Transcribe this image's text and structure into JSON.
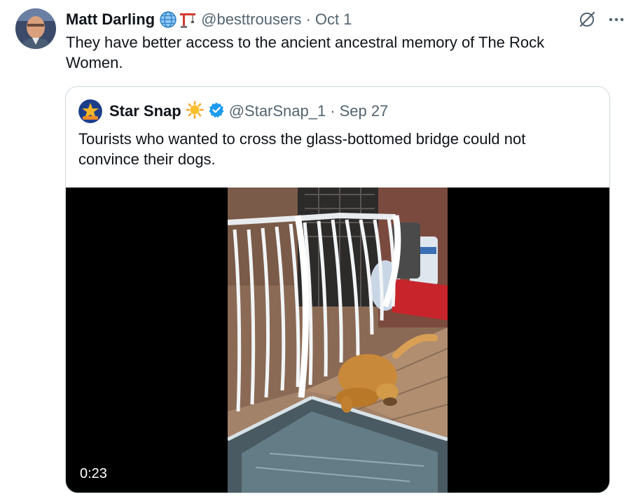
{
  "tweet": {
    "author_name": "Matt Darling",
    "handle": "@besttrousers",
    "separator": "·",
    "date": "Oct 1",
    "text": "They have better access to the ancient ancestral memory of The Rock Women.",
    "icons": [
      "globe-icon",
      "crane-icon",
      "grok-icon",
      "more-icon"
    ]
  },
  "quote": {
    "author_name": "Star Snap",
    "handle": "@StarSnap_1",
    "separator": "·",
    "date": "Sep 27",
    "text": "Tourists who wanted to cross the glass-bottomed bridge could not convince their dogs.",
    "icons": [
      "sun-emoji-icon",
      "verified-badge-icon"
    ],
    "video": {
      "timestamp": "0:23"
    }
  },
  "colors": {
    "text_primary": "#0f1419",
    "text_secondary": "#536471",
    "verified_blue": "#1d9bf0",
    "border": "#cfd9de"
  }
}
